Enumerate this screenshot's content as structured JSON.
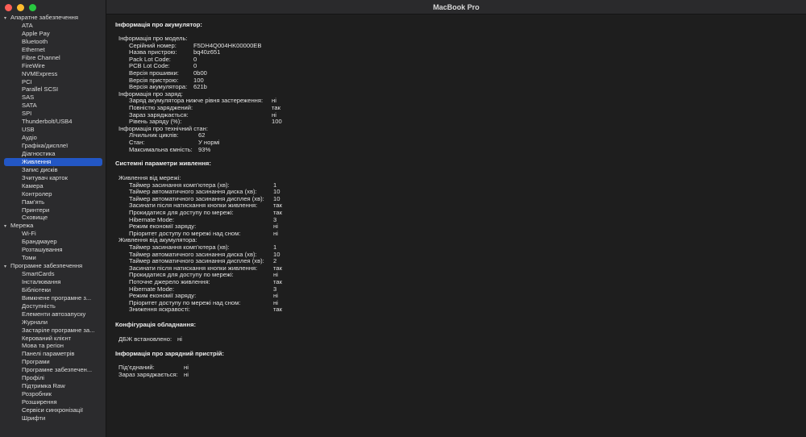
{
  "window": {
    "title": "MacBook Pro"
  },
  "sidebar": {
    "groups": [
      {
        "label": "Апаратне забезпечення",
        "items": [
          "ATA",
          "Apple Pay",
          "Bluetooth",
          "Ethernet",
          "Fibre Channel",
          "FireWire",
          "NVMExpress",
          "PCI",
          "Parallel SCSI",
          "SAS",
          "SATA",
          "SPI",
          "Thunderbolt/USB4",
          "USB",
          "Аудіо",
          "Графіка/дисплеї",
          "Діагностика",
          "Живлення",
          "Запис дисків",
          "Зчитувач карток",
          "Камера",
          "Контролер",
          "Пам’ять",
          "Принтери",
          "Сховище"
        ]
      },
      {
        "label": "Мережа",
        "items": [
          "Wi-Fi",
          "Брандмауер",
          "Розташування",
          "Томи"
        ]
      },
      {
        "label": "Програмне забезпечення",
        "items": [
          "SmartCards",
          "Інсталювання",
          "Бібліотеки",
          "Вимкнене програмне з...",
          "Доступність",
          "Елементи автозапуску",
          "Журнали",
          "Застаріле програмне за...",
          "Керований клієнт",
          "Мова та регіон",
          "Панелі параметрів",
          "Програми",
          "Програмне забезпечен...",
          "Профілі",
          "Підтримка Raw",
          "Розробник",
          "Розширення",
          "Сервіси синхронізації",
          "Шрифти"
        ]
      }
    ],
    "selected": "Живлення"
  },
  "content": {
    "battery": {
      "title": "Інформація про акумулятор:",
      "model_header": "Інформація про модель:",
      "model": [
        [
          "Серійний номер:",
          "F5DH4Q004HK00000EB"
        ],
        [
          "Назва пристрою:",
          "bq40z651"
        ],
        [
          "Pack Lot Code:",
          "0"
        ],
        [
          "PCB Lot Code:",
          "0"
        ],
        [
          "Версія прошивки:",
          "0b00"
        ],
        [
          "Версія пристрою:",
          "100"
        ],
        [
          "Версія акумулятора:",
          "621b"
        ]
      ],
      "charge_header": "Інформація про заряд:",
      "charge": [
        [
          "Заряд акумулятора нижче рівня застереження:",
          "ні"
        ],
        [
          "Повністю заряджений:",
          "так"
        ],
        [
          "Зараз заряджається:",
          "ні"
        ],
        [
          "Рівень заряду (%):",
          "100"
        ]
      ],
      "health_header": "Інформація про технічний стан:",
      "health": [
        [
          "Лічильник циклів:",
          "62"
        ],
        [
          "Стан:",
          "У нормі"
        ],
        [
          "Максимальна ємність:",
          "93%"
        ]
      ]
    },
    "power": {
      "title": "Системні параметри живлення:",
      "ac_header": "Живлення від мережі:",
      "ac": [
        [
          "Таймер засинання комп’ютера (хв):",
          "1"
        ],
        [
          "Таймер автоматичного засинання диска (хв):",
          "10"
        ],
        [
          "Таймер автоматичного засинання дисплея (хв):",
          "10"
        ],
        [
          "Засинати після натискання кнопки живлення:",
          "так"
        ],
        [
          "Прокидатися для доступу по мережі:",
          "так"
        ],
        [
          "Hibernate Mode:",
          "3"
        ],
        [
          "Режим економії заряду:",
          "ні"
        ],
        [
          "Пріоритет доступу по мережі над сном:",
          "ні"
        ]
      ],
      "batt_header": "Живлення від акумулятора:",
      "batt": [
        [
          "Таймер засинання комп’ютера (хв):",
          "1"
        ],
        [
          "Таймер автоматичного засинання диска (хв):",
          "10"
        ],
        [
          "Таймер автоматичного засинання дисплея (хв):",
          "2"
        ],
        [
          "Засинати після натискання кнопки живлення:",
          "так"
        ],
        [
          "Прокидатися для доступу по мережі:",
          "ні"
        ],
        [
          "Поточне джерело живлення:",
          "так"
        ],
        [
          "Hibernate Mode:",
          "3"
        ],
        [
          "Режим економії заряду:",
          "ні"
        ],
        [
          "Пріоритет доступу по мережі над сном:",
          "ні"
        ],
        [
          "Зниження яскравості:",
          "так"
        ]
      ]
    },
    "hardware": {
      "title": "Конфігурація обладнання:",
      "rows": [
        [
          "ДБЖ встановлено:",
          "ні"
        ]
      ]
    },
    "charger": {
      "title": "Інформація про зарядний пристрій:",
      "rows": [
        [
          "Під’єднаний:",
          "ні"
        ],
        [
          "Зараз заряджається:",
          "ні"
        ]
      ]
    }
  }
}
